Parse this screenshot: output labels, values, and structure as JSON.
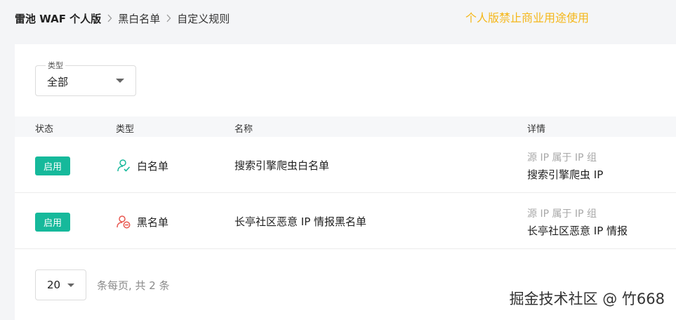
{
  "breadcrumb": {
    "root": "雷池 WAF 个人版",
    "level1": "黑白名单",
    "level2": "自定义规则"
  },
  "notice": "个人版禁止商业用途使用",
  "filter": {
    "label": "类型",
    "value": "全部"
  },
  "table": {
    "headers": {
      "status": "状态",
      "type": "类型",
      "name": "名称",
      "detail": "详情"
    },
    "rows": [
      {
        "status": "启用",
        "type": "白名单",
        "name": "搜索引擎爬虫白名单",
        "detail_sub": "源 IP 属于 IP 组",
        "detail_main": "搜索引擎爬虫 IP"
      },
      {
        "status": "启用",
        "type": "黑名单",
        "name": "长亭社区恶意 IP 情报黑名单",
        "detail_sub": "源 IP 属于 IP 组",
        "detail_main": "长亭社区恶意 IP 情报"
      }
    ]
  },
  "pagination": {
    "page_size": "20",
    "summary": "条每页, 共 2 条"
  },
  "watermark": "掘金技术社区 @ 竹668",
  "colors": {
    "status_badge": "#16b99b",
    "notice": "#f5b71a",
    "whitelist_icon": "#16b99b",
    "blacklist_icon": "#e8574f"
  }
}
